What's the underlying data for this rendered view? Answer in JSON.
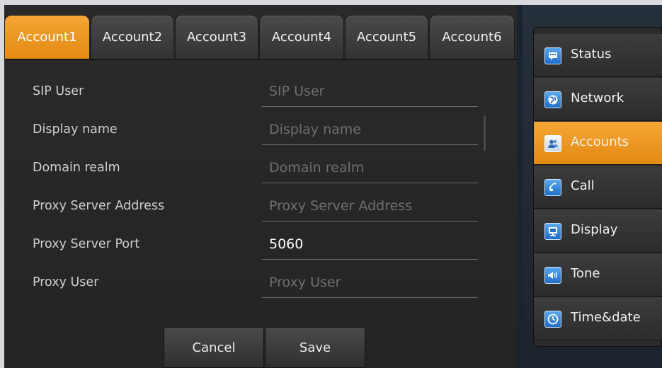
{
  "tabs": [
    {
      "label": "Account1",
      "active": true
    },
    {
      "label": "Account2",
      "active": false
    },
    {
      "label": "Account3",
      "active": false
    },
    {
      "label": "Account4",
      "active": false
    },
    {
      "label": "Account5",
      "active": false
    },
    {
      "label": "Account6",
      "active": false
    }
  ],
  "form": {
    "rows": [
      {
        "label": "SIP User",
        "value": "",
        "placeholder": "SIP User"
      },
      {
        "label": "Display name",
        "value": "",
        "placeholder": "Display name"
      },
      {
        "label": "Domain realm",
        "value": "",
        "placeholder": "Domain realm"
      },
      {
        "label": "Proxy Server Address",
        "value": "",
        "placeholder": "Proxy Server Address"
      },
      {
        "label": "Proxy Server Port",
        "value": "5060",
        "placeholder": ""
      },
      {
        "label": "Proxy User",
        "value": "",
        "placeholder": "Proxy User"
      }
    ],
    "cancel_label": "Cancel",
    "save_label": "Save"
  },
  "sidebar": {
    "items": [
      {
        "label": "Status",
        "icon": "status-icon",
        "active": false
      },
      {
        "label": "Network",
        "icon": "network-icon",
        "active": false
      },
      {
        "label": "Accounts",
        "icon": "accounts-icon",
        "active": true
      },
      {
        "label": "Call",
        "icon": "call-icon",
        "active": false
      },
      {
        "label": "Display",
        "icon": "display-icon",
        "active": false
      },
      {
        "label": "Tone",
        "icon": "tone-icon",
        "active": false
      },
      {
        "label": "Time&date",
        "icon": "clock-icon",
        "active": false
      }
    ]
  },
  "colors": {
    "accent": "#f09a24",
    "panel": "#262626",
    "background": "#1b2330"
  }
}
